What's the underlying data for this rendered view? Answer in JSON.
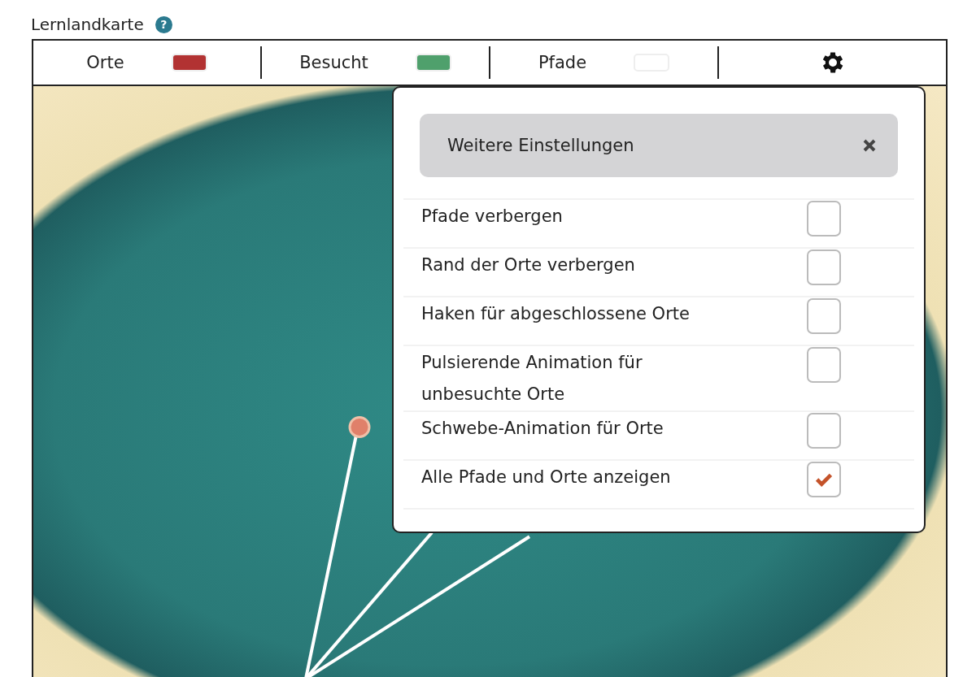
{
  "title": "Lernlandkarte",
  "help": "?",
  "legend": [
    {
      "label": "Orte",
      "color": "#b23232"
    },
    {
      "label": "Besucht",
      "color": "#4fa06c"
    },
    {
      "label": "Pfade",
      "color": "#ffffff"
    }
  ],
  "settings_panel": {
    "title": "Weitere Einstellungen",
    "options": [
      {
        "label": "Pfade verbergen",
        "checked": false
      },
      {
        "label": "Rand der Orte verbergen",
        "checked": false
      },
      {
        "label": "Haken für abgeschlossene Orte",
        "checked": false
      },
      {
        "label": "Pulsierende Animation für unbesuchte Orte",
        "checked": false
      },
      {
        "label": "Schwebe-Animation für Orte",
        "checked": false
      },
      {
        "label": "Alle Pfade und Orte anzeigen",
        "checked": true
      }
    ]
  }
}
